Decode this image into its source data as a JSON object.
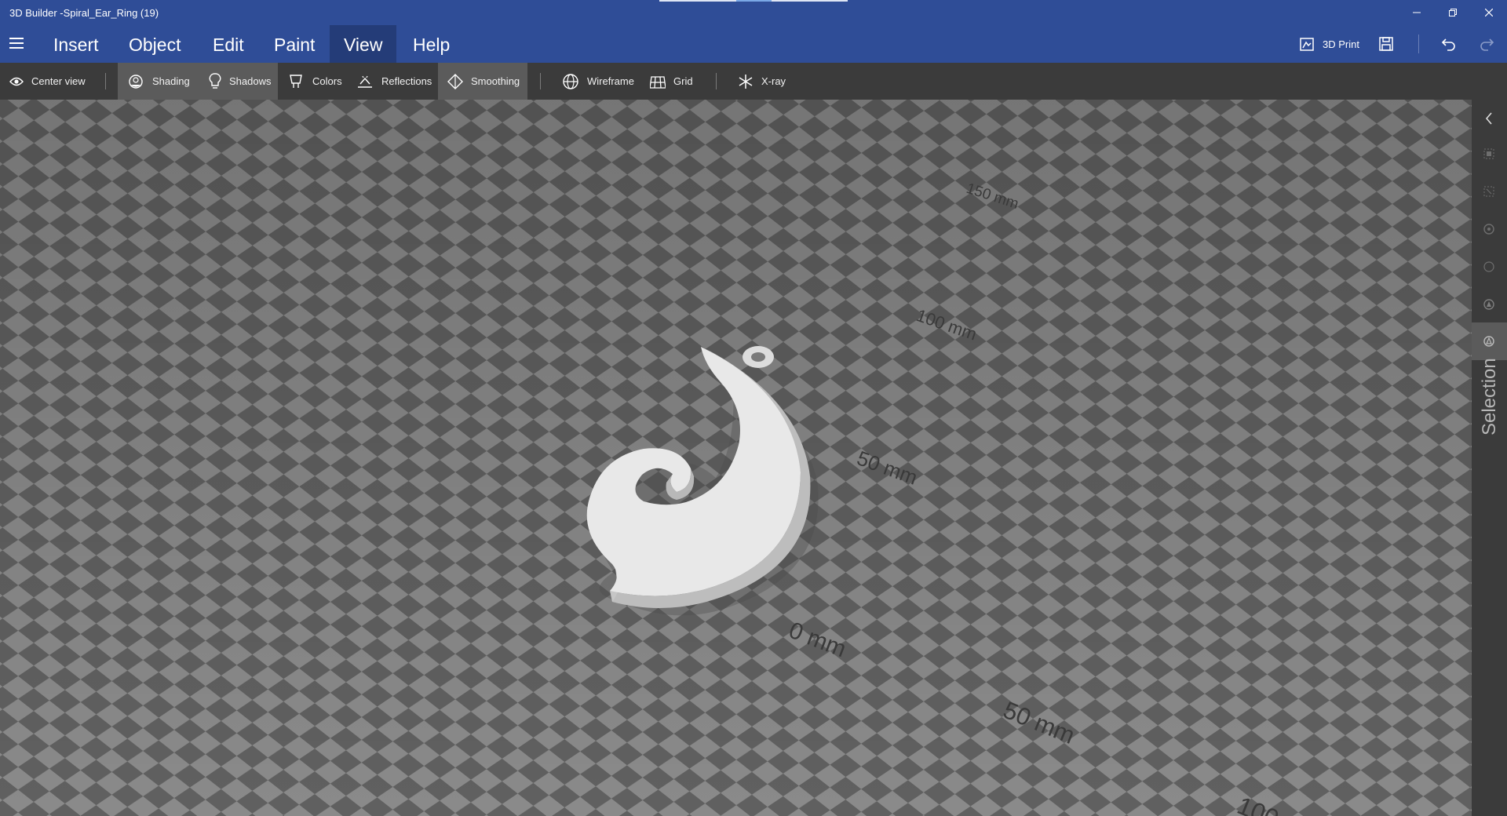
{
  "window": {
    "title": "3D Builder -Spiral_Ear_Ring (19)"
  },
  "menu": {
    "items": [
      "Insert",
      "Object",
      "Edit",
      "Paint",
      "View",
      "Help"
    ],
    "active": "View",
    "print_label": "3D Print"
  },
  "toolbar": {
    "center_view": "Center view",
    "shading": "Shading",
    "shadows": "Shadows",
    "colors": "Colors",
    "reflections": "Reflections",
    "smoothing": "Smoothing",
    "wireframe": "Wireframe",
    "grid": "Grid",
    "xray": "X-ray",
    "active": [
      "shading",
      "shadows",
      "smoothing"
    ]
  },
  "viewport": {
    "grid_labels": [
      "150 mm",
      "100 mm",
      "50 mm",
      "0 mm",
      "50 mm",
      "100"
    ],
    "object": "Spiral_Ear_Ring"
  },
  "right_panel": {
    "label": "Selection"
  },
  "colors": {
    "title_bar": "#2f4d97",
    "menu_active": "#243c78",
    "toolbar": "#3b3b3b",
    "toolbar_active": "#5b5b5b",
    "grid_light": "#8a8a8a",
    "grid_dark": "#5f5f5f",
    "model": "#e8e8e8"
  }
}
